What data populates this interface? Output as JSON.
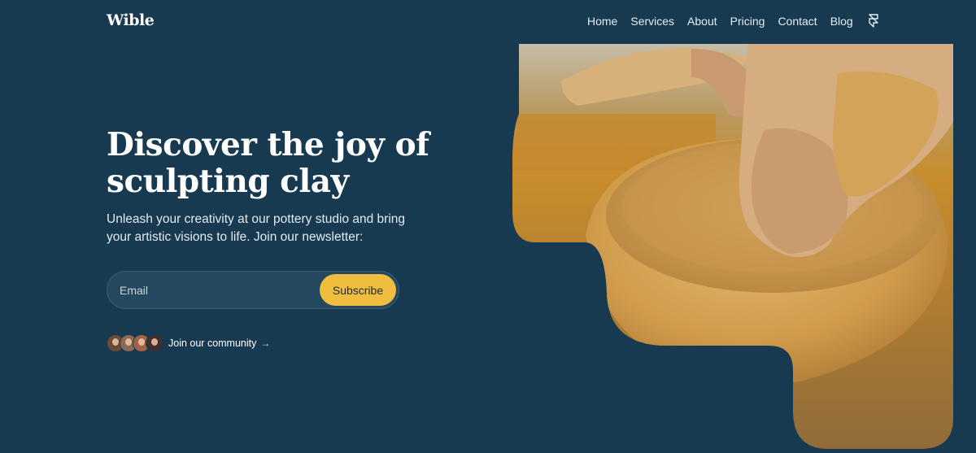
{
  "brand": {
    "logo": "Wible"
  },
  "nav": {
    "items": [
      {
        "label": "Home"
      },
      {
        "label": "Services"
      },
      {
        "label": "About"
      },
      {
        "label": "Pricing"
      },
      {
        "label": "Contact"
      },
      {
        "label": "Blog"
      }
    ],
    "icon": "framer-icon"
  },
  "hero": {
    "headline": "Discover the joy of sculpting clay",
    "subtext": "Unleash your creativity at our pottery studio and bring your artistic visions to life. Join our newsletter:",
    "email_placeholder": "Email",
    "email_value": "",
    "subscribe_label": "Subscribe",
    "community_label": "Join our community",
    "community_arrow": "→",
    "avatar_count": 4,
    "image_subject": "hands shaping a clay bowl on a pottery wheel"
  },
  "colors": {
    "background": "#173a51",
    "accent": "#efbe3f",
    "clay": "#d4a04a",
    "text": "#ffffff"
  }
}
